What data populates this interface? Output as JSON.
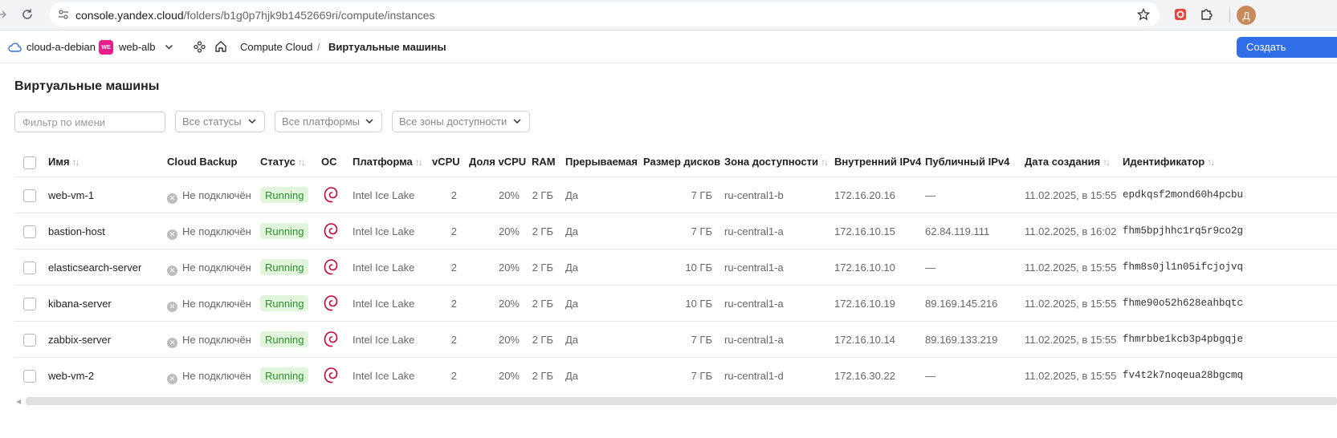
{
  "browser": {
    "url_host": "console.yandex.cloud",
    "url_path": "/folders/b1g0p7hjk9b1452669ri/compute/instances",
    "profile_initial": "Д"
  },
  "header": {
    "cloud": "cloud-a-debian",
    "folder_badge": "WE",
    "folder": "web-alb",
    "breadcrumb_service": "Compute Cloud",
    "breadcrumb_sep": "/",
    "breadcrumb_current": "Виртуальные машины",
    "create_label": "Создать"
  },
  "page": {
    "title": "Виртуальные машины"
  },
  "filters": {
    "name_placeholder": "Фильтр по имени",
    "status": "Все статусы",
    "platform": "Все платформы",
    "zone": "Все зоны доступности"
  },
  "table": {
    "columns": {
      "name": "Имя",
      "backup": "Cloud Backup",
      "status": "Статус",
      "os": "ОС",
      "platform": "Платформа",
      "vcpu": "vCPU",
      "vcpu_share": "Доля vCPU",
      "ram": "RAM",
      "preemptible": "Прерываемая",
      "disk_size": "Размер дисков",
      "zone": "Зона доступности",
      "internal_ip": "Внутренний IPv4",
      "public_ip": "Публичный IPv4",
      "created": "Дата создания",
      "id": "Идентификатор"
    },
    "rows": [
      {
        "name": "web-vm-1",
        "backup": "Не подключён",
        "status": "Running",
        "platform": "Intel Ice Lake",
        "vcpu": "2",
        "vcpu_share": "20%",
        "ram": "2 ГБ",
        "preemptible": "Да",
        "disk_size": "7 ГБ",
        "zone": "ru-central1-b",
        "internal_ip": "172.16.20.16",
        "public_ip": "—",
        "created": "11.02.2025, в 15:55",
        "id": "epdkqsf2mond60h4pcbu"
      },
      {
        "name": "bastion-host",
        "backup": "Не подключён",
        "status": "Running",
        "platform": "Intel Ice Lake",
        "vcpu": "2",
        "vcpu_share": "20%",
        "ram": "2 ГБ",
        "preemptible": "Да",
        "disk_size": "7 ГБ",
        "zone": "ru-central1-a",
        "internal_ip": "172.16.10.15",
        "public_ip": "62.84.119.111",
        "created": "11.02.2025, в 16:02",
        "id": "fhm5bpjhhc1rq5r9co2g"
      },
      {
        "name": "elasticsearch-server",
        "backup": "Не подключён",
        "status": "Running",
        "platform": "Intel Ice Lake",
        "vcpu": "2",
        "vcpu_share": "20%",
        "ram": "2 ГБ",
        "preemptible": "Да",
        "disk_size": "10 ГБ",
        "zone": "ru-central1-a",
        "internal_ip": "172.16.10.10",
        "public_ip": "—",
        "created": "11.02.2025, в 15:55",
        "id": "fhm8s0jl1n05ifcjojvq"
      },
      {
        "name": "kibana-server",
        "backup": "Не подключён",
        "status": "Running",
        "platform": "Intel Ice Lake",
        "vcpu": "2",
        "vcpu_share": "20%",
        "ram": "2 ГБ",
        "preemptible": "Да",
        "disk_size": "10 ГБ",
        "zone": "ru-central1-a",
        "internal_ip": "172.16.10.19",
        "public_ip": "89.169.145.216",
        "created": "11.02.2025, в 15:55",
        "id": "fhme90o52h628eahbqtc"
      },
      {
        "name": "zabbix-server",
        "backup": "Не подключён",
        "status": "Running",
        "platform": "Intel Ice Lake",
        "vcpu": "2",
        "vcpu_share": "20%",
        "ram": "2 ГБ",
        "preemptible": "Да",
        "disk_size": "7 ГБ",
        "zone": "ru-central1-a",
        "internal_ip": "172.16.10.14",
        "public_ip": "89.169.133.219",
        "created": "11.02.2025, в 15:55",
        "id": "fhmrbbe1kcb3p4pbgqje"
      },
      {
        "name": "web-vm-2",
        "backup": "Не подключён",
        "status": "Running",
        "platform": "Intel Ice Lake",
        "vcpu": "2",
        "vcpu_share": "20%",
        "ram": "2 ГБ",
        "preemptible": "Да",
        "disk_size": "7 ГБ",
        "zone": "ru-central1-d",
        "internal_ip": "172.16.30.22",
        "public_ip": "—",
        "created": "11.02.2025, в 15:55",
        "id": "fv4t2k7noqeua28bgcmq"
      }
    ]
  }
}
